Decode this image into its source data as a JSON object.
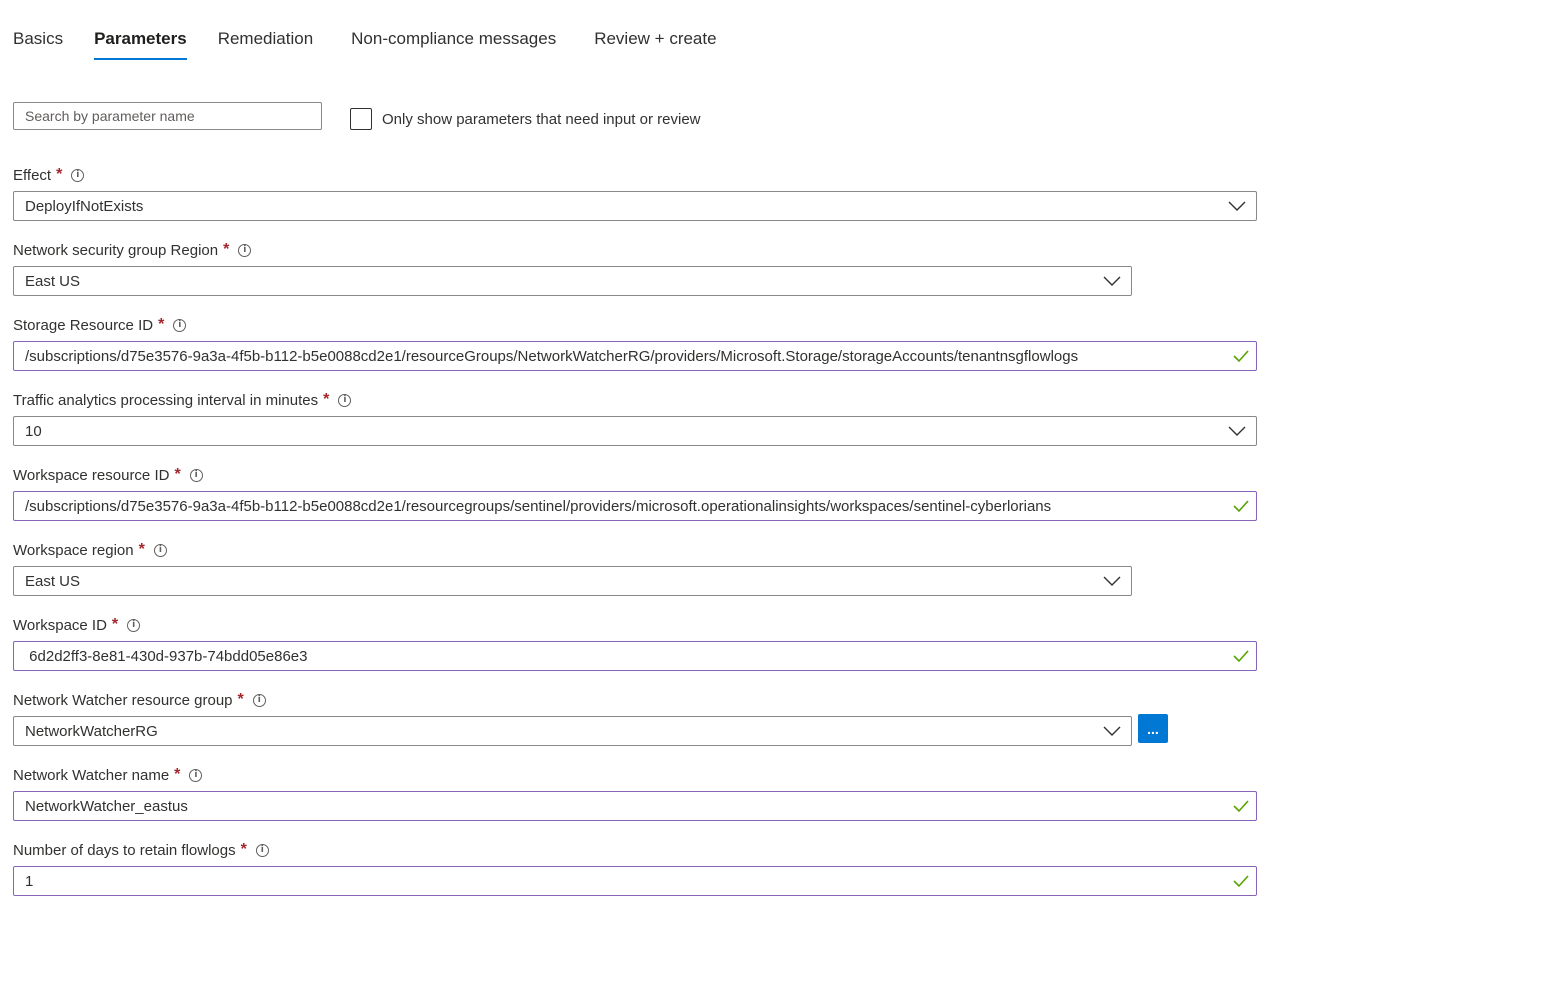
{
  "tabs": [
    {
      "label": "Basics"
    },
    {
      "label": "Parameters"
    },
    {
      "label": "Remediation"
    },
    {
      "label": "Non-compliance messages"
    },
    {
      "label": "Review + create"
    }
  ],
  "active_tab": "Parameters",
  "search": {
    "placeholder": "Search by parameter name"
  },
  "filter": {
    "label": "Only show parameters that need input or review",
    "checked": false
  },
  "required_marker": "*",
  "fields": {
    "effect": {
      "label": "Effect",
      "value": "DeployIfNotExists",
      "type": "dropdown"
    },
    "nsg_region": {
      "label": "Network security group Region",
      "value": "East US",
      "type": "dropdown"
    },
    "storage_id": {
      "label": "Storage Resource ID",
      "value": "/subscriptions/d75e3576-9a3a-4f5b-b112-b5e0088cd2e1/resourceGroups/NetworkWatcherRG/providers/Microsoft.Storage/storageAccounts/tenantnsgflowlogs",
      "type": "text",
      "valid": true
    },
    "traffic_interval": {
      "label": "Traffic analytics processing interval in minutes",
      "value": "10",
      "type": "dropdown"
    },
    "workspace_resource_id": {
      "label": "Workspace resource ID",
      "value": "/subscriptions/d75e3576-9a3a-4f5b-b112-b5e0088cd2e1/resourcegroups/sentinel/providers/microsoft.operationalinsights/workspaces/sentinel-cyberlorians",
      "type": "text",
      "valid": true
    },
    "workspace_region": {
      "label": "Workspace region",
      "value": "East US",
      "type": "dropdown"
    },
    "workspace_id": {
      "label": "Workspace ID",
      "value": " 6d2d2ff3-8e81-430d-937b-74bdd05e86e3",
      "type": "text",
      "valid": true
    },
    "nw_resource_group": {
      "label": "Network Watcher resource group",
      "value": "NetworkWatcherRG",
      "type": "dropdown",
      "browse_label": "..."
    },
    "nw_name": {
      "label": "Network Watcher name",
      "value": "NetworkWatcher_eastus",
      "type": "text",
      "valid": true
    },
    "retention_days": {
      "label": "Number of days to retain flowlogs",
      "value": "1",
      "type": "text",
      "valid": true
    }
  },
  "colors": {
    "accent": "#0078d4",
    "required": "#a4262c",
    "valid_check": "#57a300",
    "text_input_border": "#8764b8"
  },
  "icons": {
    "info": "info-icon",
    "dropdown": "chevron-down-icon",
    "valid": "checkmark-icon"
  }
}
